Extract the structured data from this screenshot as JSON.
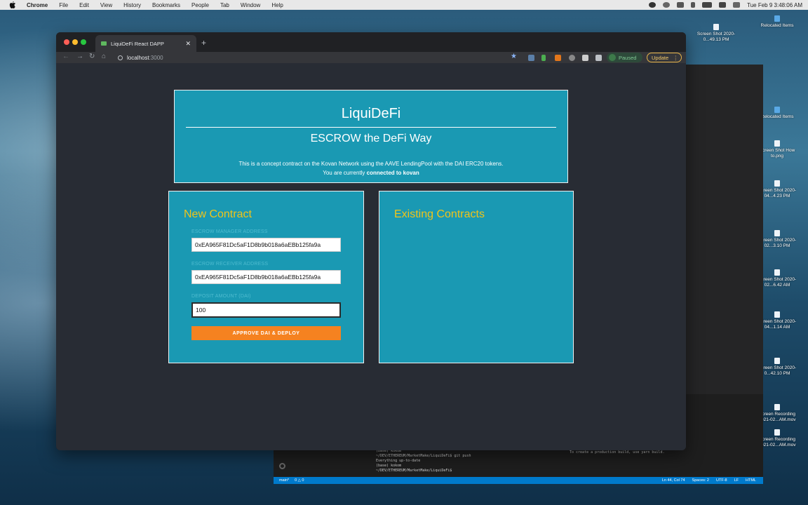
{
  "menubar": {
    "app_name": "Chrome",
    "items": [
      "File",
      "Edit",
      "View",
      "History",
      "Bookmarks",
      "People",
      "Tab",
      "Window",
      "Help"
    ],
    "clock": "Tue Feb 9  3:48:06 AM"
  },
  "desktop": {
    "items": [
      {
        "label": "Relocated Items"
      },
      {
        "label": "Screen Shot 2020-0...49.13 PM"
      },
      {
        "label": "Relocated Items"
      },
      {
        "label": "Screen Shot How to.png"
      },
      {
        "label": "Screen Shot 2020-04...4.23 PM"
      },
      {
        "label": "Screen Shot 2020-02...3.10 PM"
      },
      {
        "label": "Screen Shot 2020-02...6.42 AM"
      },
      {
        "label": "Screen Shot 2020-04...1.14 AM"
      },
      {
        "label": "Screen Shot 2020-0...42.10 PM"
      },
      {
        "label": "Screen Recording 2021-02...AM.mov"
      },
      {
        "label": "Screen Recording 2021-02...AM.mov"
      }
    ]
  },
  "vscode": {
    "terminal_lines": "(base) kokom\n~/DEV/ETHEREUM/MarketMake/LiquiDeFi$ git push\nEverything up-to-date\n(base) kokom\n~/DEV/ETHEREUM/MarketMake/LiquiDeFi$ ",
    "terminal_hint": "To create a production build, use yarn build.",
    "status_left": [
      "main*",
      "0 △ 0"
    ],
    "status_right": [
      "Ln 44, Col 74",
      "Spaces: 2",
      "UTF-8",
      "LF",
      "HTML"
    ]
  },
  "browser": {
    "tab_title": "LiquiDeFi React DAPP",
    "url_host": "localhost",
    "url_port": ":3000",
    "profile_status": "Paused",
    "update_label": "Update"
  },
  "app": {
    "title": "LiquiDeFi",
    "subtitle": "ESCROW the DeFi Way",
    "description": "This is a concept contract on the Kovan Network using the AAVE LendingPool with the DAI ERC20 tokens.",
    "connection_prefix": "You are currently ",
    "connection_status": "connected to kovan",
    "new_contract": {
      "heading": "New Contract",
      "manager_label": "ESCROW MANAGER ADDRESS",
      "manager_value": "0xEA965F81Dc5aF1D8b9b018a6aEBb125fa9a",
      "receiver_label": "ESCROW RECEIVER ADDRESS",
      "receiver_value": "0xEA965F81Dc5aF1D8b9b018a6aEBb125fa9a",
      "amount_label": "DEPOSIT AMOUNT (DAI)",
      "amount_value": "100",
      "deploy_button": "APPROVE DAI & DEPLOY"
    },
    "existing_contracts": {
      "heading": "Existing Contracts"
    }
  },
  "colors": {
    "card_bg": "#1a99b3",
    "heading_accent": "#f0c419",
    "button_accent": "#f58220",
    "page_bg": "#282c34"
  }
}
